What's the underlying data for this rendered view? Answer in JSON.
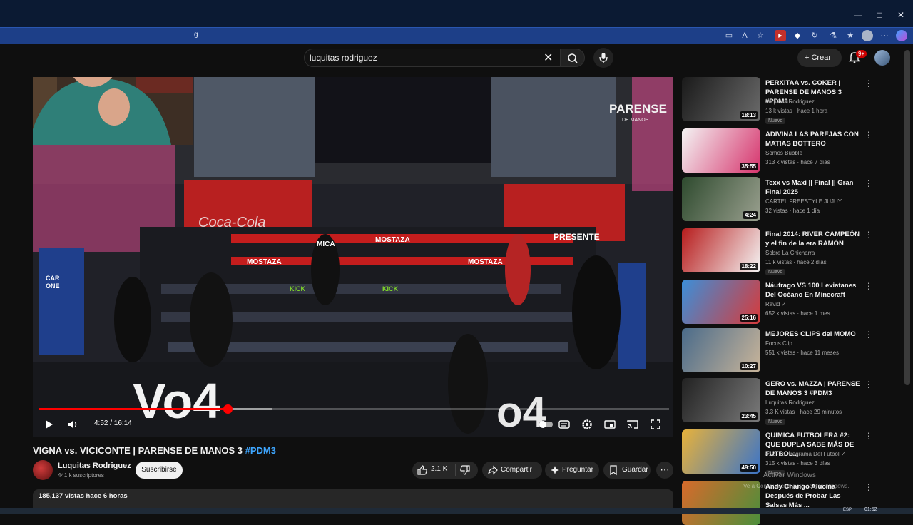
{
  "browser": {
    "tab_partial_url": "g",
    "window_controls": [
      "—",
      "□",
      "✕"
    ],
    "toolbar_icons": [
      "tab-icon",
      "read-aloud-icon",
      "star-icon",
      "extension-icon",
      "extension-icon",
      "extension-icon",
      "extension-icon",
      "favorites-icon",
      "profile-icon",
      "more-icon",
      "copilot-icon"
    ]
  },
  "header": {
    "search_query": "luquitas rodriguez",
    "create_label": "Crear",
    "notification_count": "9+"
  },
  "player": {
    "time": "4:52 / 16:14",
    "progress_fraction": 0.2995,
    "buffered_fraction": 0.37,
    "hover_marker_fraction": 0.082,
    "overlay_brand": "PARENSE DE MANOS",
    "ad_text": [
      "MOSTAZA",
      "KICK",
      "CAR ONE",
      "Coca-Cola",
      "PRESENTE",
      "MICA"
    ]
  },
  "video": {
    "title_main": "VIGNA vs. VICICONTE | PARENSE DE MANOS 3 ",
    "title_tag": "#PDM3",
    "channel": "Luquitas Rodriguez",
    "subscribers": "441 k suscriptores",
    "subscribe_label": "Suscribirse",
    "likes": "2.1 K",
    "share_label": "Compartir",
    "ask_label": "Preguntar",
    "save_label": "Guardar",
    "views_time": "185,137 vistas  hace 6 horas"
  },
  "sidebar": [
    {
      "title": "PERXITAA vs. COKER | PARENSE DE MANOS 3 #PDM3",
      "channel": "Luquitas Rodriguez",
      "meta": "13 k vistas · hace 1 hora",
      "duration": "18:13",
      "badge": "Nuevo",
      "thumb_colors": [
        "#1a1a1a",
        "#6b6b6b"
      ]
    },
    {
      "title": "ADIVINA LAS PAREJAS CON MATIAS BOTTERO",
      "channel": "Somos Bubble",
      "meta": "313 k vistas · hace 7 días",
      "duration": "35:55",
      "badge": "",
      "thumb_colors": [
        "#f4f4f4",
        "#d6336c"
      ]
    },
    {
      "title": "Texx vs Maxi || Final || Gran Final 2025",
      "channel": "CARTEL FREESTYLE JUJUY",
      "meta": "32 vistas · hace 1 día",
      "duration": "4:24",
      "badge": "",
      "thumb_colors": [
        "#2e4a2e",
        "#9aa08f"
      ]
    },
    {
      "title": "Final 2014: RIVER CAMPEÓN y el fin de la era RAMÓN",
      "channel": "Sobre La Chicharra",
      "meta": "11 k vistas · hace 2 días",
      "duration": "18:22",
      "badge": "Nuevo",
      "thumb_colors": [
        "#b71c1c",
        "#f5f5f5"
      ]
    },
    {
      "title": "Náufrago VS 100 Leviatanes Del Océano En Minecraft",
      "channel": "Ravid ✓",
      "meta": "652 k vistas · hace 1 mes",
      "duration": "25:16",
      "badge": "",
      "thumb_colors": [
        "#3b8fd9",
        "#d83a3a"
      ]
    },
    {
      "title": "MEJORES CLIPS del MOMO",
      "channel": "Focus Clip",
      "meta": "551 k vistas · hace 11 meses",
      "duration": "10:27",
      "badge": "",
      "thumb_colors": [
        "#4a6b8a",
        "#c9b59a"
      ]
    },
    {
      "title": "GERO vs. MAZZA | PARENSE DE MANOS 3 #PDM3",
      "channel": "Luquitas Rodriguez",
      "meta": "3.3 K vistas · hace 29 minutos",
      "duration": "23:45",
      "badge": "Nuevo",
      "thumb_colors": [
        "#222222",
        "#7a7a7a"
      ]
    },
    {
      "title": "QUIMICA FUTBOLERA #2: QUE DUPLA SABE MÁS DE FUTBOL...",
      "channel": "412 - El Programa Del Fútbol ✓",
      "meta": "315 k vistas · hace 3 días",
      "duration": "49:50",
      "badge": "Nuevo",
      "thumb_colors": [
        "#e8b23a",
        "#3a74c9"
      ]
    },
    {
      "title": "Andy Chango Alucina Después de Probar Las Salsas Más ...",
      "channel": "",
      "meta": "",
      "duration": "",
      "badge": "",
      "thumb_colors": [
        "#d86a2b",
        "#4b8f3b"
      ]
    }
  ],
  "watermark": {
    "line1": "Activar Windows",
    "line2": "Ve a Configuración para activar Windows."
  },
  "taskbar": {
    "time": "01:52",
    "lang": "ESP"
  }
}
